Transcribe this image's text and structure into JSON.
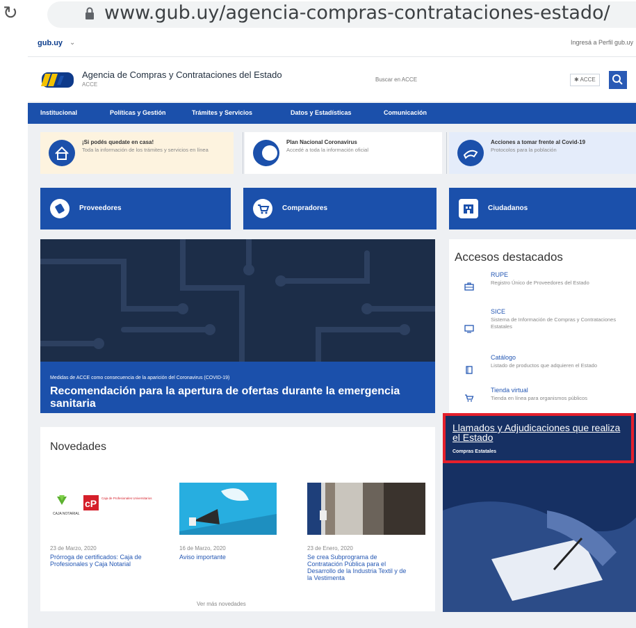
{
  "browser": {
    "url": "www.gub.uy/agencia-compras-contrataciones-estado/"
  },
  "gubbar": {
    "site": "gub.uy",
    "caret": "⌄",
    "right_link": "Ingresá a Perfil gub.uy"
  },
  "header": {
    "agency_name": "Agencia de Compras y Contrataciones del Estado",
    "agency_acronym": "ACCE",
    "search_placeholder": "Buscar en ACCE",
    "search_scope": "✱ ACCE"
  },
  "nav": {
    "items": [
      "Institucional",
      "Políticas y Gestión",
      "Trámites y Servicios",
      "Datos y Estadísticas",
      "Comunicación"
    ]
  },
  "notices": [
    {
      "title": "¡Si podés quedate en casa!",
      "desc": "Toda la información de los trámites y servicios en línea"
    },
    {
      "title": "Plan Nacional Coronavirus",
      "desc": "Accedé a toda la información oficial"
    },
    {
      "title": "Acciones a tomar frente al Covid-19",
      "desc": "Protocolos para la población"
    }
  ],
  "roles": [
    {
      "label": "Proveedores"
    },
    {
      "label": "Compradores"
    },
    {
      "label": "Ciudadanos"
    }
  ],
  "hero": {
    "kicker": "Medidas de ACCE como consecuencia de la aparición del Coronavirus (COVID-19)",
    "title": "Recomendación para la apertura de ofertas durante la emergencia sanitaria"
  },
  "accesos": {
    "heading": "Accesos destacados",
    "items": [
      {
        "title": "RUPE",
        "desc": "Registro Único de Proveedores del Estado"
      },
      {
        "title": "SICE",
        "desc": "Sistema de Información de Compras y Contrataciones Estatales"
      },
      {
        "title": "Catálogo",
        "desc": "Listado de productos que adquieren el Estado"
      },
      {
        "title": "Tienda virtual",
        "desc": "Tienda en línea para organismos públicos"
      }
    ]
  },
  "novedades": {
    "heading": "Novedades",
    "items": [
      {
        "date": "23 de Marzo, 2020",
        "title": "Prórroga de certificados: Caja de Profesionales y Caja Notarial"
      },
      {
        "date": "16 de Marzo, 2020",
        "title": "Aviso importante"
      },
      {
        "date": "23 de Enero, 2020",
        "title": "Se crea Subprograma de Contratación Pública para el Desarrollo de la Industria Textil y de la Vestimenta"
      }
    ],
    "more": "Ver más novedades"
  },
  "llamados": {
    "title": "Llamados y Adjudicaciones que realiza el Estado",
    "subtitle": "Compras Estatales"
  },
  "logo_text": {
    "caja_notarial": "CAJA NOTARIAL",
    "caja_prof": "Caja de Profesionales Universitarios",
    "cp": "cP"
  },
  "colors": {
    "primary": "#1b50ab",
    "highlight_box": "#e5202c",
    "link": "#2457b3"
  }
}
